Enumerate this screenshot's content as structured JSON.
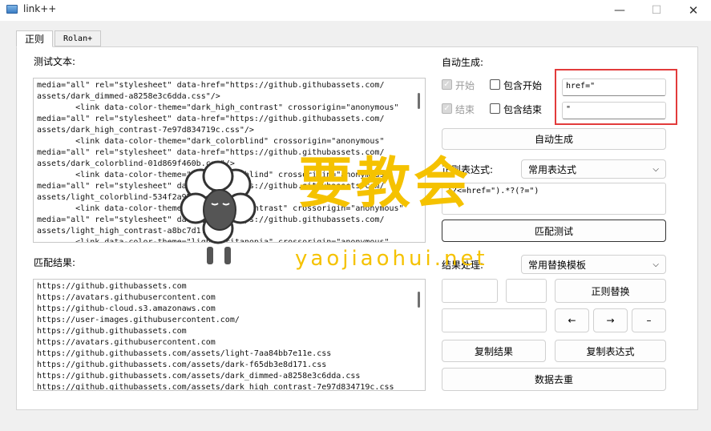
{
  "window": {
    "title": "link++",
    "minimize": "—",
    "maximize": "☐",
    "close": "✕"
  },
  "tabs": [
    "正则",
    "Rolan+"
  ],
  "test_text": {
    "label": "测试文本:",
    "lines": [
      "media=\"all\" rel=\"stylesheet\" data-href=\"https://github.githubassets.com/",
      "assets/dark_dimmed-a8258e3c6dda.css\"/>",
      "        <link data-color-theme=\"dark_high_contrast\" crossorigin=\"anonymous\"",
      "media=\"all\" rel=\"stylesheet\" data-href=\"https://github.githubassets.com/",
      "assets/dark_high_contrast-7e97d834719c.css\"/>",
      "        <link data-color-theme=\"dark_colorblind\" crossorigin=\"anonymous\"",
      "media=\"all\" rel=\"stylesheet\" data-href=\"https://github.githubassets.com/",
      "assets/dark_colorblind-01d869f460b.css\"/>",
      "        <link data-color-theme=\"light_colorblind\" crossorigin=\"anonymous\"",
      "media=\"all\" rel=\"stylesheet\" data-href=\"https://github.githubassets.com/",
      "assets/light_colorblind-534f2a971240.css\"/>",
      "        <link data-color-theme=\"light_high_contrast\" crossorigin=\"anonymous\"",
      "media=\"all\" rel=\"stylesheet\" data-href=\"https://github.githubassets.com/",
      "assets/light_high_contrast-a8bc7d1...\"/>",
      "        <link data-color-theme=\"light_tritanopia\" crossorigin=\"anonymous\""
    ]
  },
  "match_result": {
    "label": "匹配结果:",
    "lines": [
      "https://github.githubassets.com",
      "https://avatars.githubusercontent.com",
      "https://github-cloud.s3.amazonaws.com",
      "https://user-images.githubusercontent.com/",
      "https://github.githubassets.com",
      "https://avatars.githubusercontent.com",
      "https://github.githubassets.com/assets/light-7aa84bb7e11e.css",
      "https://github.githubassets.com/assets/dark-f65db3e8d171.css",
      "https://github.githubassets.com/assets/dark_dimmed-a8258e3c6dda.css",
      "https://github.githubassets.com/assets/dark_high_contrast-7e97d834719c.css"
    ]
  },
  "auto_gen": {
    "label": "自动生成:",
    "start_label": "开始",
    "end_label": "结束",
    "include_start_label": "包含开始",
    "include_end_label": "包含结束",
    "start_value": "href=\"",
    "end_value": "\"",
    "button": "自动生成"
  },
  "regex": {
    "label": "正则表达式:",
    "select_value": "常用表达式",
    "value": "(?<=href=\").*?(?=\")",
    "match_test_button": "匹配测试"
  },
  "result_proc": {
    "label": "结果处理:",
    "select_value": "常用替换模板",
    "regex_replace_button": "正则替换",
    "left_arrow": "←",
    "right_arrow": "→",
    "dash": "–",
    "copy_result_button": "复制结果",
    "copy_regex_button": "复制表达式",
    "dedupe_button": "数据去重"
  },
  "watermark": {
    "cn": "要教会",
    "en": "yaojiaohui.net"
  },
  "colors": {
    "highlight": "#e23b3b",
    "watermark": "#f5c200"
  }
}
